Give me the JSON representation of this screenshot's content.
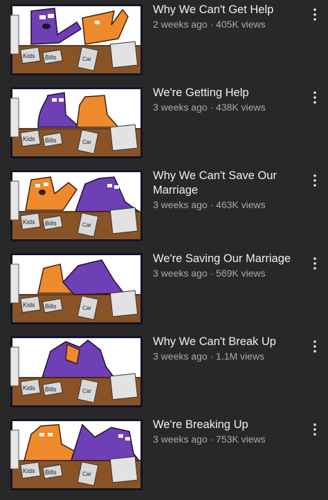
{
  "videos": [
    {
      "title": "Why We Can't Get Help",
      "views": "405K views",
      "age": "2 weeks ago",
      "meta": "2 weeks ago · 405K views"
    },
    {
      "title": "We're Getting Help",
      "views": "438K views",
      "age": "3 weeks ago",
      "meta": "3 weeks ago · 438K views"
    },
    {
      "title": "Why We Can't Save Our Marriage",
      "views": "463K views",
      "age": "3 weeks ago",
      "meta": "3 weeks ago · 463K views"
    },
    {
      "title": "We're Saving Our Marriage",
      "views": "569K views",
      "age": "3 weeks ago",
      "meta": "3 weeks ago · 569K views"
    },
    {
      "title": "Why We Can't Break Up",
      "views": "1.1M views",
      "age": "3 weeks ago",
      "meta": "3 weeks ago · 1.1M views"
    },
    {
      "title": "We're Breaking Up",
      "views": "753K views",
      "age": "3 weeks ago",
      "meta": "3 weeks ago · 753K views"
    }
  ],
  "thumbnail_props": {
    "label_1": "Kids",
    "label_2": "Bills",
    "label_3": "Car"
  },
  "icons": {
    "more": "vertical-ellipsis-icon"
  },
  "colors": {
    "background": "#282828",
    "title": "#f1f1f1",
    "meta": "#aaaaaa",
    "purple": "#6f3fb5",
    "orange": "#ef8a2c",
    "desk": "#8a5326"
  }
}
